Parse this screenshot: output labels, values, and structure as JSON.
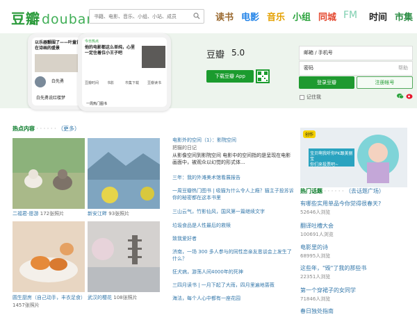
{
  "header": {
    "logo_cn": "豆瓣",
    "logo_en": "douban",
    "search_placeholder": "书籍、电影、音乐、小组、小站、成员",
    "nav": [
      {
        "label": "读书",
        "color": "#9b6b32"
      },
      {
        "label": "电影",
        "color": "#2384e8"
      },
      {
        "label": "音乐",
        "color": "#e4a000"
      },
      {
        "label": "小组",
        "color": "#2aa33c"
      },
      {
        "label": "同城",
        "color": "#e4482f"
      },
      {
        "label": "FM",
        "color": "#7fcfb0"
      },
      {
        "label": "时间",
        "color": "#222222"
      },
      {
        "label": "市集",
        "color": "#2b8c44"
      }
    ]
  },
  "banner": {
    "phone1_text": "以乐器颤围了——叶童曾在诗画的盛景",
    "phone1_user": "白先勇",
    "phone1_bottom": "白先勇说红楼梦",
    "phone2_text": "他的电影都这么单纯，心里一定住着位小王子吧",
    "phone2_tab": "今日热点",
    "phone2_tabs": [
      "豆瓣时间",
      "书影",
      "市集下载",
      "豆瓣读书"
    ],
    "phone2_bottom": "一周热门图书",
    "app_name": "豆瓣",
    "app_version": "5.0",
    "download_label": "下载豆瓣 App",
    "login": {
      "email_placeholder": "邮箱 / 手机号",
      "password_placeholder": "密码",
      "help": "帮助",
      "login_label": "登录豆瓣",
      "register_label": "注册帐号",
      "remember_label": "记住我"
    }
  },
  "hot": {
    "title": "热点内容",
    "more": "（更多）",
    "pics": [
      {
        "caption": "二福君-愿游",
        "count": "172张照片",
        "color": "#9bbd86"
      },
      {
        "caption": "新安江畔",
        "count": "93张照片",
        "color": "#7fa9c9"
      },
      {
        "caption": "圆生厨房（自己动手，丰衣足食）",
        "count": "1457张照片",
        "color": "#d7a878"
      },
      {
        "caption": "武汉的樱花",
        "count": "108张照片",
        "color": "#c9c5c2"
      }
    ],
    "articles": [
      {
        "title": "电影外的空间（1）：影院空间"
      },
      {
        "sub": "把猫的日记"
      },
      {
        "desc": "从影像空间到影院空间 电影中的空间指的是呈现在电影画面中，被观众以幻觉的形式体..."
      },
      {
        "title": "三年：我的外滩美术馆看展报告"
      },
      {
        "title": "一周豆瓣热门图书 | 吸猫为什么令人上瘾？猫主子投苏诉你的秘密都在这本书里"
      },
      {
        "title": "三山云气，竹影仙风，国风第一篇继续文字"
      },
      {
        "title": "垃圾食品是人性最后的救赎"
      },
      {
        "title": "致我爱好者"
      },
      {
        "title": "济南，一场 300 多人参与的同性恋亲友恳谈会上发生了什么？"
      },
      {
        "title": "狂犬病，游荡人间4000年的死神"
      },
      {
        "title": "三四月读书 | 一月下起了大雨，四月里遍地蔷薇"
      },
      {
        "title": "海法，每个人心中都有一座花园"
      }
    ]
  },
  "ad": {
    "badge": "创作",
    "line1": "宝贝啊我听你PK跟美丽宝",
    "line2": "你们来投票吧~"
  },
  "topics": {
    "title": "热门话题",
    "more": "（去话题广场）",
    "items": [
      {
        "title": "有哪些实用单品今你觉得很春天?",
        "count": "52646人浏览"
      },
      {
        "title": "翻译吐槽大会",
        "count": "100691人浏览"
      },
      {
        "title": "电影里的诗",
        "count": "68995人浏览"
      },
      {
        "title": "这些年，\"毁\"了我的那些书",
        "count": "22351人浏览"
      },
      {
        "title": "第一个穿裙子的女同学",
        "count": "71846人浏览"
      },
      {
        "title": "春日独处指南"
      }
    ]
  }
}
